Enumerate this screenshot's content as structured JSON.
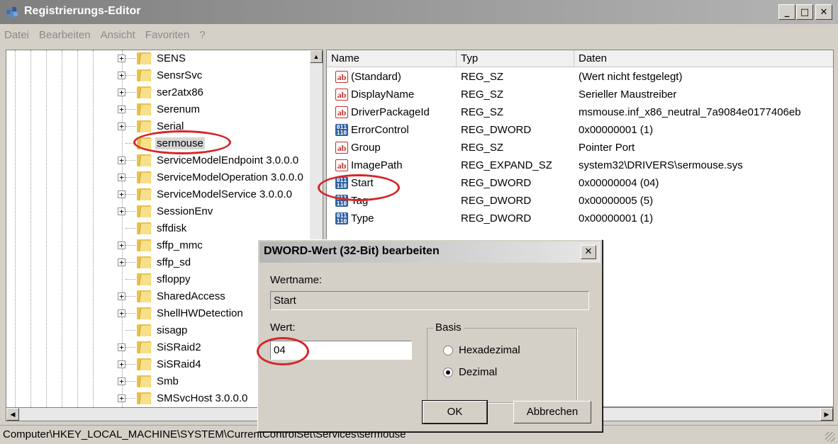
{
  "window": {
    "title": "Registrierungs-Editor"
  },
  "menu": [
    "Datei",
    "Bearbeiten",
    "Ansicht",
    "Favoriten",
    "?"
  ],
  "tree": {
    "items": [
      {
        "label": "SENS",
        "expandable": true
      },
      {
        "label": "SensrSvc",
        "expandable": true
      },
      {
        "label": "ser2atx86",
        "expandable": true
      },
      {
        "label": "Serenum",
        "expandable": true
      },
      {
        "label": "Serial",
        "expandable": true
      },
      {
        "label": "sermouse",
        "expandable": false,
        "selected": true
      },
      {
        "label": "ServiceModelEndpoint 3.0.0.0",
        "expandable": true
      },
      {
        "label": "ServiceModelOperation 3.0.0.0",
        "expandable": true
      },
      {
        "label": "ServiceModelService 3.0.0.0",
        "expandable": true
      },
      {
        "label": "SessionEnv",
        "expandable": true
      },
      {
        "label": "sffdisk",
        "expandable": false
      },
      {
        "label": "sffp_mmc",
        "expandable": true
      },
      {
        "label": "sffp_sd",
        "expandable": true
      },
      {
        "label": "sfloppy",
        "expandable": false
      },
      {
        "label": "SharedAccess",
        "expandable": true
      },
      {
        "label": "ShellHWDetection",
        "expandable": true
      },
      {
        "label": "sisagp",
        "expandable": false
      },
      {
        "label": "SiSRaid2",
        "expandable": true
      },
      {
        "label": "SiSRaid4",
        "expandable": true
      },
      {
        "label": "Smb",
        "expandable": true
      },
      {
        "label": "SMSvcHost 3.0.0.0",
        "expandable": true
      }
    ]
  },
  "values": {
    "columns": [
      "Name",
      "Typ",
      "Daten"
    ],
    "rows": [
      {
        "icon": "string-value-icon",
        "name": "(Standard)",
        "type": "REG_SZ",
        "data": "(Wert nicht festgelegt)"
      },
      {
        "icon": "string-value-icon",
        "name": "DisplayName",
        "type": "REG_SZ",
        "data": "Serieller Maustreiber"
      },
      {
        "icon": "string-value-icon",
        "name": "DriverPackageId",
        "type": "REG_SZ",
        "data": "msmouse.inf_x86_neutral_7a9084e0177406eb"
      },
      {
        "icon": "binary-value-icon",
        "name": "ErrorControl",
        "type": "REG_DWORD",
        "data": "0x00000001 (1)"
      },
      {
        "icon": "string-value-icon",
        "name": "Group",
        "type": "REG_SZ",
        "data": "Pointer Port"
      },
      {
        "icon": "string-value-icon",
        "name": "ImagePath",
        "type": "REG_EXPAND_SZ",
        "data": "system32\\DRIVERS\\sermouse.sys"
      },
      {
        "icon": "binary-value-icon",
        "name": "Start",
        "type": "REG_DWORD",
        "data": "0x00000004 (04)"
      },
      {
        "icon": "binary-value-icon",
        "name": "Tag",
        "type": "REG_DWORD",
        "data": "0x00000005 (5)"
      },
      {
        "icon": "binary-value-icon",
        "name": "Type",
        "type": "REG_DWORD",
        "data": "0x00000001 (1)"
      }
    ]
  },
  "status_bar": {
    "path": "Computer\\HKEY_LOCAL_MACHINE\\SYSTEM\\CurrentControlSet\\Services\\sermouse"
  },
  "dialog": {
    "title": "DWORD-Wert (32-Bit) bearbeiten",
    "value_name_label": "Wertname:",
    "value_name": "Start",
    "value_label": "Wert:",
    "value": "04",
    "base_label": "Basis",
    "base_options": [
      "Hexadezimal",
      "Dezimal"
    ],
    "base_selected": "Dezimal",
    "ok_label": "OK",
    "cancel_label": "Abbrechen"
  },
  "icons": {
    "string_value": "ab",
    "binary_value": "011\n110"
  },
  "colors": {
    "annotation": "#d4262a"
  }
}
